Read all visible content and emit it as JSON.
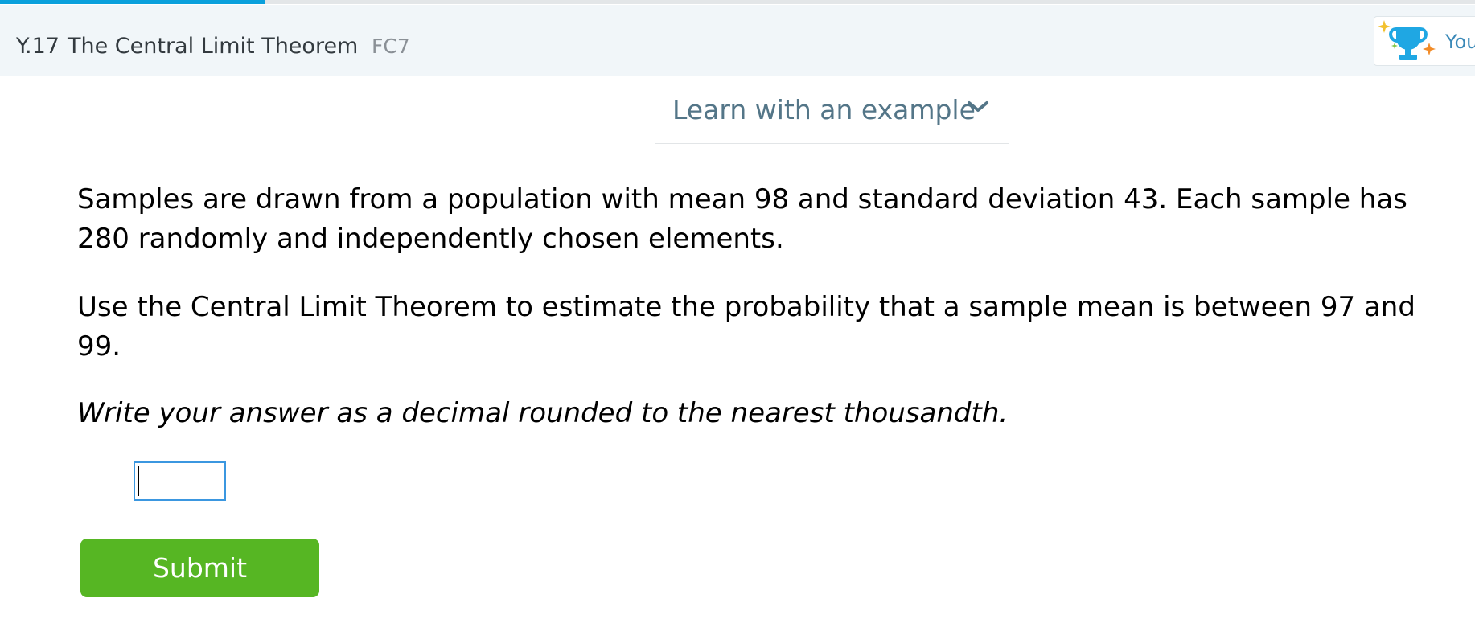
{
  "header": {
    "skill_code": "Y.17",
    "skill_name": "The Central Limit Theorem",
    "skill_id": "FC7",
    "award_text": "You"
  },
  "progress": {
    "fraction": 0.18
  },
  "learn": {
    "label": "Learn with an example"
  },
  "question": {
    "paragraph_1": "Samples are drawn from a population with mean 98 and standard deviation 43. Each sample has 280 randomly and independently chosen elements.",
    "paragraph_2": "Use the Central Limit Theorem to estimate the probability that a sample mean is between 97 and 99.",
    "instruction": "Write your answer as a decimal rounded to the nearest thousandth."
  },
  "answer": {
    "value": ""
  },
  "submit": {
    "label": "Submit"
  },
  "colors": {
    "progress": "#0aa0dc",
    "submit": "#56b623",
    "header_bg": "#f1f6f9",
    "learn_text": "#547688",
    "input_border": "#3b97e0"
  },
  "icons": {
    "award": "trophy-icon",
    "learn_toggle": "chevron-down-icon"
  }
}
